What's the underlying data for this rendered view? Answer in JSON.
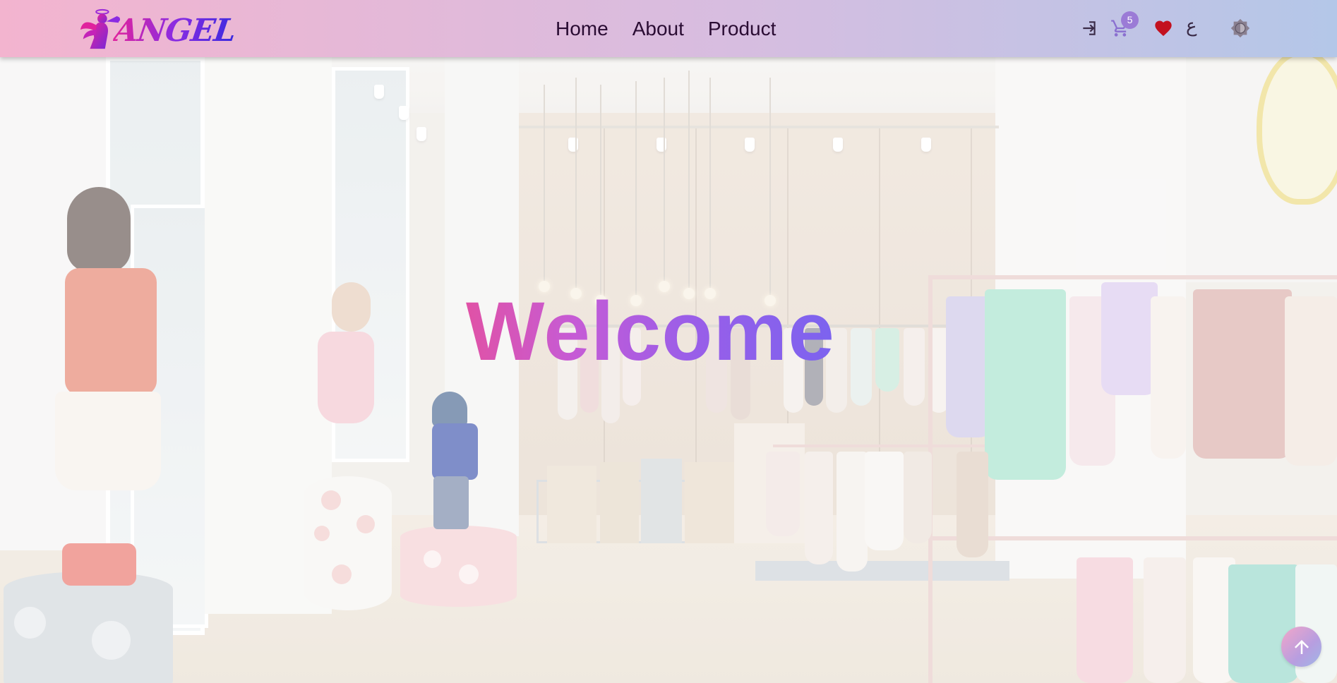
{
  "brand": {
    "logo_text": "ANGEL",
    "logo_icon": "angel-trumpet-icon",
    "colors": {
      "pink": "#e0239d",
      "purple": "#8a2be2",
      "blue": "#3a2bdf"
    }
  },
  "navbar": {
    "gradient": [
      "#f3b4cf",
      "#d7bde0",
      "#b4c7e8"
    ],
    "links": [
      {
        "label": "Home"
      },
      {
        "label": "About"
      },
      {
        "label": "Product"
      }
    ],
    "icons": {
      "login": "login-icon",
      "cart": "cart-icon",
      "wishlist": "heart-icon",
      "language": "language-icon",
      "theme": "theme-toggle-icon"
    },
    "cart_count": "5",
    "language_label": "ع",
    "heart_color": "#c3111f"
  },
  "hero": {
    "heading": "Welcome",
    "heading_gradient": [
      "#e052a6",
      "#9b5ee8",
      "#7c63ef"
    ]
  },
  "scroll_top": {
    "icon": "arrow-up-icon"
  }
}
